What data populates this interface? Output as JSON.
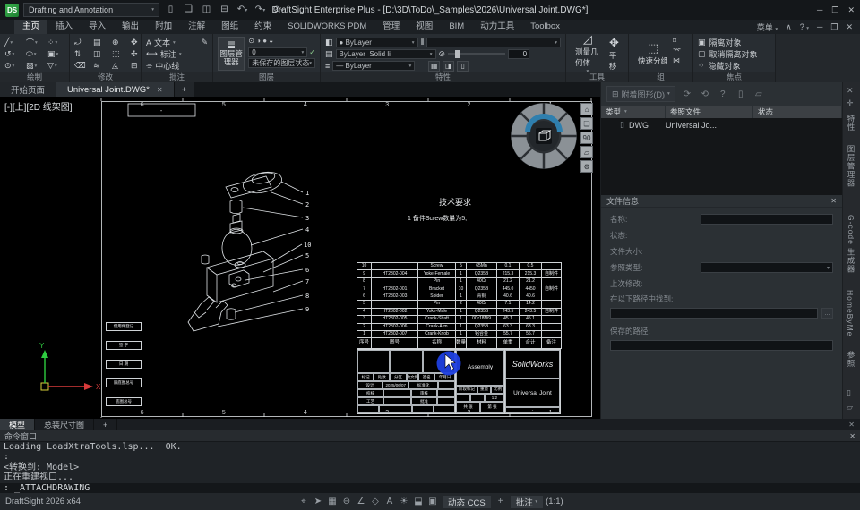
{
  "titlebar": {
    "logo": "DS",
    "workspace": "Drafting and Annotation",
    "title": "DraftSight Enterprise Plus - [D:\\3D\\ToDo\\_Samples\\2026\\Universal Joint.DWG*]"
  },
  "icons": {
    "caret": "▾",
    "check": "✓",
    "close": "✕",
    "minimize": "─",
    "restore": "❐",
    "help": "?",
    "pin": "✛",
    "chevron_up": "∧",
    "new_file": "▯",
    "open": "❏",
    "save": "◫",
    "print": "⊟",
    "undo": "↶",
    "redo": "↷",
    "erase": "⊘",
    "text_tool": "A",
    "dimension_tool": "⟷",
    "centerline_tool": "⌯",
    "pen": "✎",
    "layer_manager": "≣",
    "layer_states": "⊙ ◑ ● ◒",
    "prop_match": "◧",
    "prop_linetype": "▤",
    "prop_lineweight": "≡",
    "prop_hatch": "⫴",
    "prop_transparency": "⊘",
    "measure": "◿",
    "pan": "✥",
    "quick_group": "⬚",
    "group_a": "⌑",
    "group_b": "⌤",
    "group_c": "⋈",
    "isolate": "▣",
    "unisolate": "▢",
    "hide": "⁘",
    "attach": "⊞",
    "ref_reload": "⟳",
    "ref_refresh": "⟲",
    "ref_doc": "▯",
    "ref_doc2": "▱",
    "dwg_file": "▯",
    "browse": "...",
    "home": "⌂",
    "cube": "❏",
    "gear": "⚙",
    "plus": "+"
  },
  "menubar": {
    "tabs": [
      "主页",
      "插入",
      "导入",
      "输出",
      "附加",
      "注解",
      "图纸",
      "约束",
      "SOLIDWORKS PDM",
      "管理",
      "视图",
      "BIM",
      "动力工具",
      "Toolbox"
    ],
    "active": "主页",
    "menu_label": "菜单"
  },
  "ribbon": {
    "groups": {
      "draw": "绘制",
      "modify": "修改",
      "annotate": "批注",
      "layer": "图层",
      "properties": "特性",
      "tools": "工具",
      "group": "组",
      "focus": "焦点"
    },
    "draw_icons": [
      "╱",
      "⌒",
      "⁘",
      "↺",
      "⬭",
      "▣",
      "⊙",
      "▨",
      "▽"
    ],
    "modify_icons": [
      "⤾",
      "▤",
      "⊕",
      "✥",
      "⇅",
      "◫",
      "⬚",
      "✢",
      "⌫",
      "≋",
      "◬",
      "⊟"
    ],
    "annotate": {
      "text": "文本",
      "dimension": "标注",
      "centerline": "中心线"
    },
    "layer": {
      "manager": "图层管理器",
      "active_layer": "0",
      "state": "未保存的图层状态"
    },
    "properties": {
      "color_value": "ByLayer",
      "linetype_value": "ByLayer",
      "linetype_style": "Solid li",
      "lineweight_value": "ByLayer",
      "transparency": "0"
    },
    "tools": {
      "measure": "测量几何体",
      "pan": "平移"
    },
    "group": {
      "quick_group": "快速分组"
    },
    "focus": {
      "isolate": "隔离对象",
      "unisolate": "取消隔离对象",
      "hide": "隐藏对象"
    }
  },
  "doc_tabs": {
    "start": "开始页面",
    "doc": "Universal Joint.DWG*"
  },
  "viewport": {
    "label": "[-][上][2D 线架图]"
  },
  "drawing": {
    "tech_title": "技术要求",
    "tech_note": "1 备件Screw数量为5;",
    "corner_mark": "-",
    "zone_numbers": [
      "6",
      "5",
      "4",
      "3",
      "2",
      "1"
    ],
    "balloons": [
      "1",
      "2",
      "3",
      "4",
      "10",
      "5",
      "6",
      "7",
      "8",
      "9"
    ],
    "ucs": {
      "x": "X",
      "y": "Y"
    },
    "nav_rotate": "90"
  },
  "left_strip": [
    "借用件登记",
    "签 字",
    "日 期",
    "旧底图总号",
    "底图总号"
  ],
  "bom": {
    "columns": [
      "序号",
      "图号",
      "名称",
      "数量",
      "材料",
      "单重",
      "合计",
      "备注"
    ],
    "rows": [
      {
        "n": "10",
        "code": "",
        "name": "Screw",
        "qty": "5",
        "mat": "65Mn",
        "unit": "0.1",
        "total": "0.5",
        "note": ""
      },
      {
        "n": "9",
        "code": "HT2302-004",
        "name": "Yoke-Female",
        "qty": "1",
        "mat": "Q235B",
        "unit": "215.3",
        "total": "215.3",
        "note": "自制件"
      },
      {
        "n": "8",
        "code": "",
        "name": "Pin",
        "qty": "1",
        "mat": "40Cr",
        "unit": "21.2",
        "total": "21.2",
        "note": ""
      },
      {
        "n": "7",
        "code": "HT2302-001",
        "name": "Bracket",
        "qty": "10",
        "mat": "Q235B",
        "unit": "445.0",
        "total": "4450",
        "note": "自制件"
      },
      {
        "n": "6",
        "code": "HT2302-003",
        "name": "Spider",
        "qty": "1",
        "mat": "青铜",
        "unit": "40.6",
        "total": "40.6",
        "note": ""
      },
      {
        "n": "5",
        "code": "",
        "name": "Pin",
        "qty": "2",
        "mat": "40Cr",
        "unit": "7.1",
        "total": "14.2",
        "note": ""
      },
      {
        "n": "4",
        "code": "HT2302-002",
        "name": "Yoke-Male",
        "qty": "1",
        "mat": "Q235B",
        "unit": "243.5",
        "total": "243.5",
        "note": "自制件"
      },
      {
        "n": "3",
        "code": "HT2302-005",
        "name": "Crank-Shaft",
        "qty": "1",
        "mat": "0Cr18Ni9",
        "unit": "45.1",
        "total": "45.1",
        "note": ""
      },
      {
        "n": "2",
        "code": "HT2302-006",
        "name": "Crank-Arm",
        "qty": "1",
        "mat": "Q235B",
        "unit": "63.3",
        "total": "63.3",
        "note": ""
      },
      {
        "n": "1",
        "code": "HT2302-007",
        "name": "Crank-Knob",
        "qty": "1",
        "mat": "铝合金",
        "unit": "55.7",
        "total": "55.7",
        "note": ""
      }
    ]
  },
  "titleblock": {
    "assembly": "Assembly",
    "brand": "SolidWorks",
    "part": "Universal Joint",
    "dash": "-",
    "mark": "标记",
    "count": "处数",
    "zone": "分区",
    "change_no": "更改文件号",
    "sign": "签名",
    "date": "年月日",
    "design": "设计",
    "design_date": "2025/06/07",
    "standard": "标准化",
    "check": "校核",
    "process": "工艺",
    "audit": "审核",
    "approve": "批准",
    "stage": "阶段标记",
    "weight": "重量",
    "scale_label": "比例",
    "scale": "1:2",
    "sheets": "共 张",
    "sheet_no": "第 张"
  },
  "references_panel": {
    "attach": "附着图形(D)",
    "col_type": "类型",
    "col_file": "参照文件",
    "col_status": "状态",
    "row_type": "DWG",
    "row_file": "Universal Jo..."
  },
  "file_info": {
    "title": "文件信息",
    "name": "名称:",
    "status": "状态:",
    "size": "文件大小:",
    "ref_type": "参照类型:",
    "modified": "上次修改:",
    "found_path": "在以下路径中找到:",
    "saved_path": "保存的路径:"
  },
  "side_tabs": [
    "特性",
    "图层管理器",
    "G-code 生成器",
    "HomeByMe",
    "参照"
  ],
  "sheet_tabs": {
    "model": "模型",
    "sheet": "总装尺寸图"
  },
  "command": {
    "title": "命令窗口",
    "lines": [
      "Loading LoadXtraTools.lsp...  OK.",
      ":",
      "<转换到: Model>",
      "正在重建视口...",
      ": _ATTACHDRAWING"
    ]
  },
  "statusbar": {
    "app": "DraftSight 2026 x64",
    "icons": [
      "⌖",
      "➤",
      "▦",
      "⊖",
      "∠",
      "◇",
      "A",
      "☀",
      "⬓",
      "▣"
    ],
    "dyn_ccs": "动态 CCS",
    "plus": "+",
    "annot": "批注",
    "scale": "(1:1)"
  }
}
